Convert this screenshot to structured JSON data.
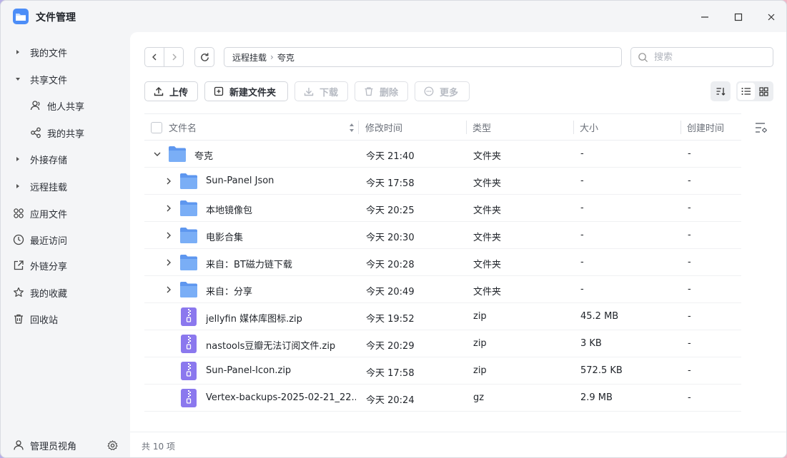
{
  "app": {
    "title": "文件管理"
  },
  "sidebar": {
    "items": [
      {
        "label": "我的文件"
      },
      {
        "label": "共享文件"
      },
      {
        "label": "他人共享"
      },
      {
        "label": "我的共享"
      },
      {
        "label": "外接存储"
      },
      {
        "label": "远程挂载"
      },
      {
        "label": "应用文件"
      },
      {
        "label": "最近访问"
      },
      {
        "label": "外链分享"
      },
      {
        "label": "我的收藏"
      },
      {
        "label": "回收站"
      }
    ],
    "footer_label": "管理员视角"
  },
  "path": {
    "segments": [
      "远程挂载",
      "夸克"
    ]
  },
  "search": {
    "placeholder": "搜索"
  },
  "toolbar": {
    "upload": "上传",
    "new_folder": "新建文件夹",
    "download": "下载",
    "delete": "删除",
    "more": "更多"
  },
  "table": {
    "headers": {
      "name": "文件名",
      "modified": "修改时间",
      "type": "类型",
      "size": "大小",
      "created": "创建时间"
    },
    "rows": [
      {
        "name": "夸克",
        "modified": "今天 21:40",
        "type": "文件夹",
        "size": "-",
        "created": "-"
      },
      {
        "name": "Sun-Panel Json",
        "modified": "今天 17:58",
        "type": "文件夹",
        "size": "-",
        "created": "-"
      },
      {
        "name": "本地镜像包",
        "modified": "今天 20:25",
        "type": "文件夹",
        "size": "-",
        "created": "-"
      },
      {
        "name": "电影合集",
        "modified": "今天 20:30",
        "type": "文件夹",
        "size": "-",
        "created": "-"
      },
      {
        "name": "来自：BT磁力链下载",
        "modified": "今天 20:28",
        "type": "文件夹",
        "size": "-",
        "created": "-"
      },
      {
        "name": "来自：分享",
        "modified": "今天 20:49",
        "type": "文件夹",
        "size": "-",
        "created": "-"
      },
      {
        "name": "jellyfin 媒体库图标.zip",
        "modified": "今天 19:52",
        "type": "zip",
        "size": "45.2 MB",
        "created": "-"
      },
      {
        "name": "nastools豆瓣无法订阅文件.zip",
        "modified": "今天 20:29",
        "type": "zip",
        "size": "3 KB",
        "created": "-"
      },
      {
        "name": "Sun-Panel-Icon.zip",
        "modified": "今天 17:58",
        "type": "zip",
        "size": "572.5 KB",
        "created": "-"
      },
      {
        "name": "Vertex-backups-2025-02-21_22...",
        "modified": "今天 20:24",
        "type": "gz",
        "size": "2.9 MB",
        "created": "-"
      }
    ]
  },
  "status": {
    "count": "共 10 项"
  },
  "colors": {
    "folder": "#6fa4f4",
    "archive": "#8f7cf0",
    "accent": "#2f6df6"
  }
}
